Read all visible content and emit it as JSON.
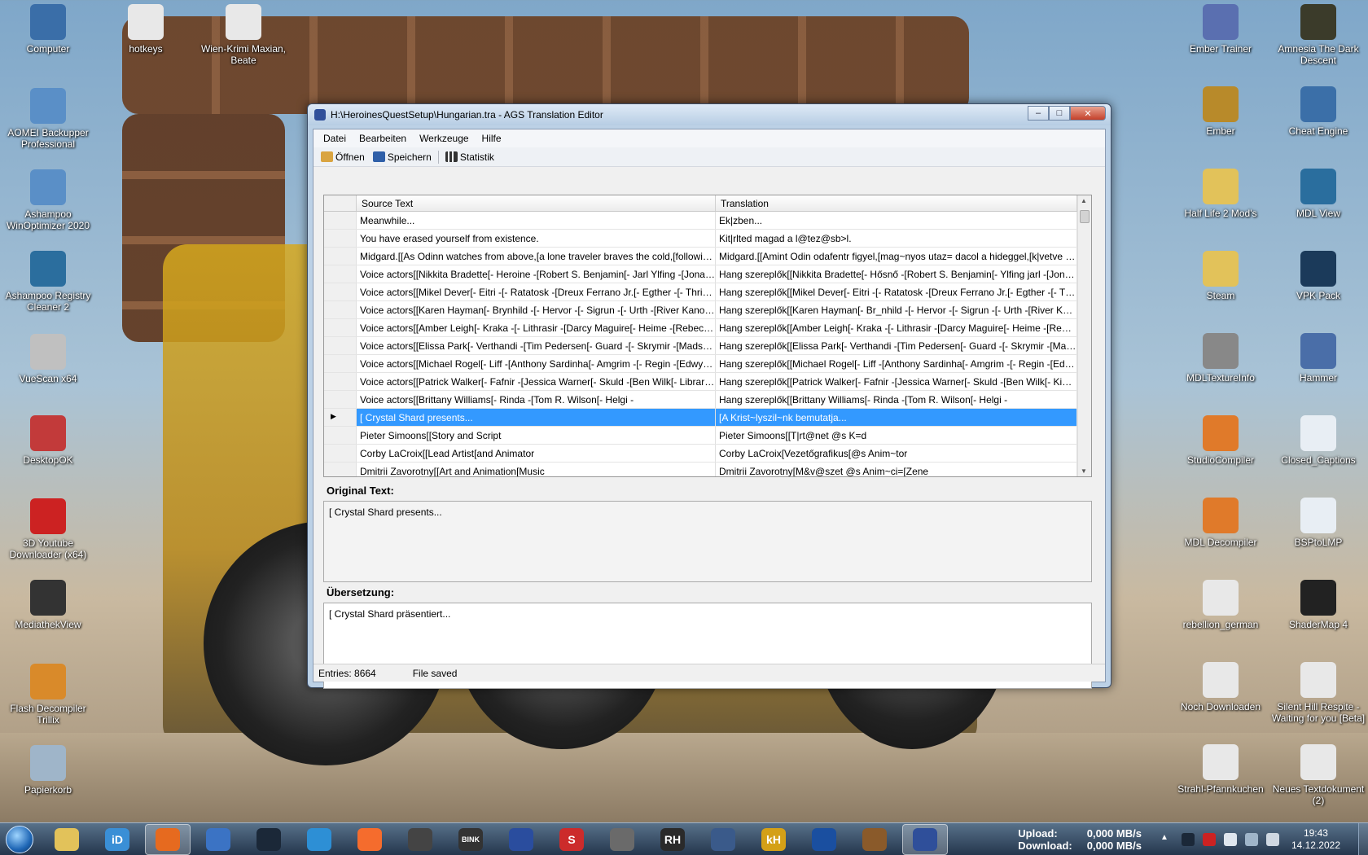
{
  "desktop_left": [
    {
      "label": "Computer",
      "icon": "computer-icon",
      "color": "#3a6ea8"
    },
    {
      "label": "hotkeys",
      "icon": "text-file-icon",
      "color": "#e8e8e8"
    },
    {
      "label": "Wien-Krimi Maxian, Beate",
      "icon": "text-file-icon",
      "color": "#e8e8e8"
    },
    {
      "label": "AOMEI Backupper Professional",
      "icon": "gear-shield-icon",
      "color": "#5a8fc7"
    },
    {
      "label": "Ashampoo WinOptimizer 2020",
      "icon": "gear-shield-icon",
      "color": "#5a8fc7"
    },
    {
      "label": "Ashampoo Registry Cleaner 2",
      "icon": "registry-icon",
      "color": "#2b6e9e"
    },
    {
      "label": "VueScan x64",
      "icon": "scanner-icon",
      "color": "#c0c0c0"
    },
    {
      "label": "DesktopOK",
      "icon": "grid-icon",
      "color": "#c23a3a"
    },
    {
      "label": "3D Youtube Downloader (x64)",
      "icon": "download-icon",
      "color": "#cc2222"
    },
    {
      "label": "MediathekView",
      "icon": "clapper-icon",
      "color": "#333333"
    },
    {
      "label": "Flash Decompiler Trillix",
      "icon": "boxes-icon",
      "color": "#d98a2a"
    },
    {
      "label": "Papierkorb",
      "icon": "recycle-bin-icon",
      "color": "#9fb5c9"
    }
  ],
  "desktop_right": [
    {
      "label": "Ember Trainer",
      "icon": "trainer-icon",
      "color": "#5a6fb0"
    },
    {
      "label": "Amnesia The Dark Descent",
      "icon": "amnesia-icon",
      "color": "#3b3b2a"
    },
    {
      "label": "Ember",
      "icon": "ember-icon",
      "color": "#b88a2a"
    },
    {
      "label": "Cheat Engine",
      "icon": "cheat-engine-icon",
      "color": "#3b6fa8"
    },
    {
      "label": "Half Life 2 Mod's",
      "icon": "folder-icon",
      "color": "#e2c25a"
    },
    {
      "label": "MDL View",
      "icon": "lambda-icon",
      "color": "#2a6e9e"
    },
    {
      "label": "Steam",
      "icon": "folder-icon",
      "color": "#e2c25a"
    },
    {
      "label": "VPK Pack",
      "icon": "steam-icon",
      "color": "#1b3a5a"
    },
    {
      "label": "MDLTextureInfo",
      "icon": "magnifier-icon",
      "color": "#888888"
    },
    {
      "label": "Hammer",
      "icon": "hammer-icon",
      "color": "#4a6ea8"
    },
    {
      "label": "StudioCompiler",
      "icon": "hl-shield-icon",
      "color": "#e07a2a"
    },
    {
      "label": "Closed_Captions",
      "icon": "gear-icon",
      "color": "#e8eef4"
    },
    {
      "label": "MDL Decompiler",
      "icon": "hl-shield-icon",
      "color": "#e07a2a"
    },
    {
      "label": "BSPtoLMP",
      "icon": "gear-icon",
      "color": "#e8eef4"
    },
    {
      "label": "rebellion_german",
      "icon": "text-file-icon",
      "color": "#e8e8e8"
    },
    {
      "label": "ShaderMap 4",
      "icon": "shadermap-icon",
      "color": "#222222"
    },
    {
      "label": "Noch Downloaden",
      "icon": "text-file-icon",
      "color": "#e8e8e8"
    },
    {
      "label": "Silent Hill Respite - Waiting for you [Beta]",
      "icon": "text-file-icon",
      "color": "#e8e8e8"
    },
    {
      "label": "Strahl-Pfannkuchen",
      "icon": "text-file-icon",
      "color": "#e8e8e8"
    },
    {
      "label": "Neues Textdokument (2)",
      "icon": "text-file-icon",
      "color": "#e8e8e8"
    }
  ],
  "window": {
    "title": "H:\\HeroinesQuestSetup\\Hungarian.tra - AGS Translation Editor",
    "minimize": "–",
    "maximize": "□",
    "close": "✕"
  },
  "menu": [
    "Datei",
    "Bearbeiten",
    "Werkzeuge",
    "Hilfe"
  ],
  "toolbar": {
    "open": "Öffnen",
    "save": "Speichern",
    "stats": "Statistik"
  },
  "grid": {
    "headers": [
      "Source Text",
      "Translation"
    ],
    "selected_marker": "▶",
    "rows": [
      {
        "source": "Meanwhile...",
        "translation": "Ek|zben..."
      },
      {
        "source": "You have erased yourself from existence.",
        "translation": "Kit|rlted magad a l@tez@sb>l."
      },
      {
        "source": "Midgard.[[As Odinn watches from above,[a lone traveler braves the cold,[following her calli...",
        "translation": "Midgard.[[Amint Odin odafentr figyel,[mag~nyos utaz= dacol a hideggel,[k|vetve elh\\vat~..."
      },
      {
        "source": "Voice actors[[Nikkita Bradette[- Heroine -[Robert S. Benjamin[- Jarl Ylfing -[Jonathan Cook...",
        "translation": "Hang szereplők[[Nikkita Bradette[- Hősnő -[Robert S. Benjamin[- Ylfing jarl -[Jonathan Cooke..."
      },
      {
        "source": "Voice actors[[Mikel Dever[- Eitri -[- Ratatosk -[Dreux Ferrano Jr.[- Egther -[- Thrivaldi #1 -",
        "translation": "Hang szereplők[[Mikel Dever[- Eitri -[- Ratatosk -[Dreux Ferrano Jr.[- Egther -[- Thrivaldi #1 -"
      },
      {
        "source": "Voice actors[[Karen Hayman[- Brynhild -[- Hervor -[- Sigrun -[- Urth -[River Kanoff[- Aurvand...",
        "translation": "Hang szereplők[[Karen Hayman[- Br_nhild -[- Hervor -[- Sigrun -[- Urth -[River Kanoff[- Aurv..."
      },
      {
        "source": "Voice actors[[Amber Leigh[- Kraka -[- Lithrasir -[Darcy Maguire[- Heime -[Rebecca McCarth...",
        "translation": "Hang szereplők[[Amber Leigh[- Kraka -[- Lithrasir -[Darcy Maguire[- Heime -[Rebecca McCa..."
      },
      {
        "source": "Voice actors[[Elissa Park[- Verthandi -[Tim Pedersen[- Guard -[- Skrymir -[Mads L. B. Pouls...",
        "translation": "Hang szereplők[[Elissa Park[- Verthandi -[Tim Pedersen[- Guard -[- Skrymir -[Mads L. B. Po..."
      },
      {
        "source": "Voice actors[[Michael Rogel[- Liff -[Anthony Sardinha[- Amgrim -[- Regin -[Edwyn Tiong[- Al...",
        "translation": "Hang szereplők[[Michael Rogel[- Liff -[Anthony Sardinha[- Amgrim -[- Regin -[Edwyn Tiong[-..."
      },
      {
        "source": "Voice actors[[Patrick Walker[- Fafnir -[Jessica Warner[- Skuld -[Ben Wilk[- Librarian -[- Sigu...",
        "translation": "Hang szereplők[[Patrick Walker[- Fafnir -[Jessica Warner[- Skuld -[Ben Wilk[- Kinyvt~ros -[-..."
      },
      {
        "source": "Voice actors[[Brittany Williams[- Rinda -[Tom R. Wilson[- Helgi -",
        "translation": "Hang szereplők[[Brittany Williams[- Rinda -[Tom R. Wilson[- Helgi -"
      },
      {
        "source": "[   Crystal Shard presents...",
        "translation": "[A Krist~lyszil~nk bemutatja...",
        "selected": true
      },
      {
        "source": "Pieter Simoons[[Story and Script",
        "translation": "Pieter Simoons[[T|rt@net @s K=d"
      },
      {
        "source": "Corby LaCroix[[Lead Artist[and Animator",
        "translation": "Corby LaCroix[Vezetőgrafikus[@s Anim~tor"
      },
      {
        "source": "Dmitrii Zavorotny[[Art and Animation[Music",
        "translation": "Dmitrii Zavorotny[M&v@szet @s Anim~ci=[Zene"
      }
    ]
  },
  "original_label": "Original Text:",
  "original_text": "[   Crystal Shard presents...",
  "translation_label": "Übersetzung:",
  "translation_text": "[   Crystal Shard präsentiert...",
  "status": {
    "entries": "Entries: 8664",
    "state": "File saved"
  },
  "taskbar": {
    "apps": [
      {
        "name": "explorer-icon",
        "color": "#e2c25a",
        "text": ""
      },
      {
        "name": "idm-icon",
        "color": "#3a8fd6",
        "text": "iD"
      },
      {
        "name": "firefox-icon",
        "color": "#e66a1f",
        "text": "",
        "active": true
      },
      {
        "name": "thunderbird-icon",
        "color": "#3b73c4",
        "text": ""
      },
      {
        "name": "steam-icon",
        "color": "#1b2838",
        "text": ""
      },
      {
        "name": "browser-icon",
        "color": "#2d8fd5",
        "text": ""
      },
      {
        "name": "origin-icon",
        "color": "#f56c2d",
        "text": ""
      },
      {
        "name": "flame-icon",
        "color": "#444444",
        "text": ""
      },
      {
        "name": "bink-icon",
        "color": "#333333",
        "text": "BINK"
      },
      {
        "name": "arrow-app-icon",
        "color": "#2a4d9e",
        "text": ""
      },
      {
        "name": "s-app-icon",
        "color": "#cc2b2b",
        "text": "S"
      },
      {
        "name": "tools-icon",
        "color": "#6a6a6a",
        "text": ""
      },
      {
        "name": "rh-icon",
        "color": "#2a2a2a",
        "text": "RH"
      },
      {
        "name": "settings-icon",
        "color": "#3a5a8a",
        "text": ""
      },
      {
        "name": "kh-icon",
        "color": "#d4a017",
        "text": "kH"
      },
      {
        "name": "headphones-icon",
        "color": "#1a4fa0",
        "text": ""
      },
      {
        "name": "speaker-icon",
        "color": "#8a5a2a",
        "text": ""
      },
      {
        "name": "ags-icon",
        "color": "#2f4f9a",
        "text": "",
        "active": true
      }
    ],
    "upload_label": "Upload:",
    "upload_value": "0,000 MB/s",
    "download_label": "Download:",
    "download_value": "0,000 MB/s",
    "time": "19:43",
    "date": "14.12.2022"
  }
}
